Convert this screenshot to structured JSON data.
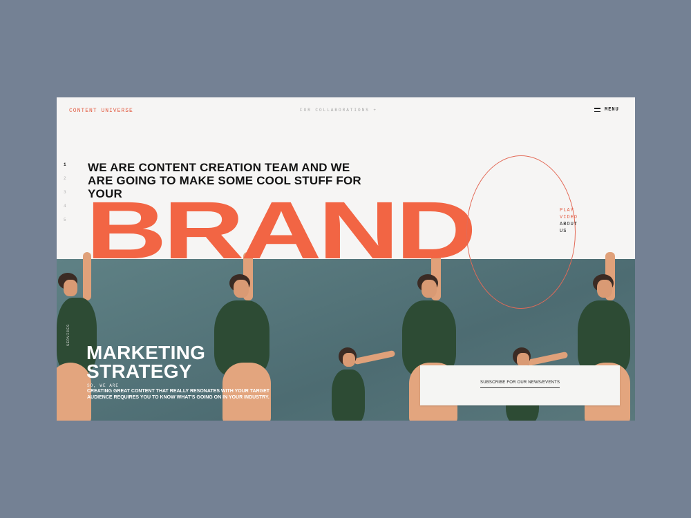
{
  "header": {
    "logo": "CONTENT UNIVERSE",
    "collab_link": "FOR COLLABORATIONS +",
    "menu_label": "MENU"
  },
  "pager": {
    "items": [
      "1",
      "2",
      "3",
      "4",
      "5"
    ],
    "active": "1"
  },
  "hero": {
    "headline": "WE ARE CONTENT CREATION TEAM AND WE ARE GOING TO MAKE SOME COOL STUFF FOR YOUR",
    "big_word": "BRAND",
    "play_video": [
      "PLAY",
      "VIDEO"
    ],
    "about_us": [
      "ABOUT",
      "US"
    ]
  },
  "section": {
    "vertical_label": "SERVICES",
    "title_line1": "MARKETING",
    "title_line2": "STRATEGY",
    "kicker": "SO, WE ARE",
    "description": "CREATING GREAT CONTENT THAT REALLY RESONATES WITH YOUR TARGET AUDIENCE REQUIRES YOU TO KNOW WHAT'S GOING ON IN YOUR INDUSTRY."
  },
  "subscribe": {
    "label": "SUBSCRIBE FOR OUR NEWS/EVENTS"
  },
  "colors": {
    "accent": "#f26544",
    "background": "#748194",
    "panel": "#f6f5f4",
    "photo_wall": "#58777c"
  }
}
